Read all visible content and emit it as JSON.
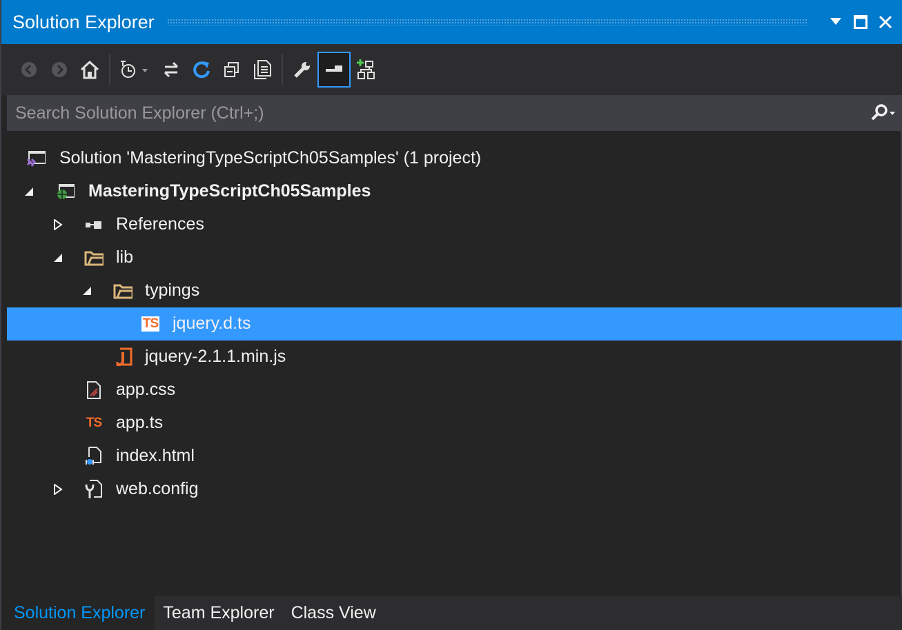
{
  "window": {
    "title": "Solution Explorer"
  },
  "colors": {
    "accent": "#007acc",
    "selection": "#3399ff",
    "background": "#252526",
    "ts_orange": "#f26b2a",
    "folder": "#dcb67a"
  },
  "toolbar": {
    "buttons": [
      {
        "name": "back",
        "icon": "back-arrow-icon"
      },
      {
        "name": "forward",
        "icon": "forward-arrow-icon"
      },
      {
        "name": "home",
        "icon": "home-icon"
      },
      {
        "name": "pending-changes-filter",
        "icon": "clock-filter-icon"
      },
      {
        "name": "sync-with-active-document",
        "icon": "sync-icon"
      },
      {
        "name": "refresh",
        "icon": "refresh-icon"
      },
      {
        "name": "collapse-all",
        "icon": "collapse-all-icon"
      },
      {
        "name": "show-all-files",
        "icon": "show-all-files-icon"
      },
      {
        "name": "properties",
        "icon": "wrench-icon"
      },
      {
        "name": "preview-selected-items",
        "icon": "preview-icon",
        "active": true
      },
      {
        "name": "view-class-diagram",
        "icon": "class-diagram-icon"
      }
    ]
  },
  "search": {
    "placeholder": "Search Solution Explorer (Ctrl+;)"
  },
  "tree": {
    "items": [
      {
        "label": "Solution 'MasteringTypeScriptCh05Samples' (1 project)",
        "icon": "solution-icon",
        "expander": "none"
      },
      {
        "label": "MasteringTypeScriptCh05Samples",
        "icon": "web-project-icon",
        "expander": "expanded",
        "bold": true
      },
      {
        "label": "References",
        "icon": "references-icon",
        "expander": "collapsed"
      },
      {
        "label": "lib",
        "icon": "folder-open-icon",
        "expander": "expanded"
      },
      {
        "label": "typings",
        "icon": "folder-open-icon",
        "expander": "expanded"
      },
      {
        "label": "jquery.d.ts",
        "icon": "ts-file-icon",
        "expander": "none",
        "selected": true
      },
      {
        "label": "jquery-2.1.1.min.js",
        "icon": "js-file-icon",
        "expander": "none"
      },
      {
        "label": "app.css",
        "icon": "css-file-icon",
        "expander": "none"
      },
      {
        "label": "app.ts",
        "icon": "ts-file-icon",
        "expander": "none"
      },
      {
        "label": "index.html",
        "icon": "html-file-icon",
        "expander": "none"
      },
      {
        "label": "web.config",
        "icon": "config-file-icon",
        "expander": "collapsed"
      }
    ],
    "ts_badge": "TS"
  },
  "tabs": [
    {
      "label": "Solution Explorer",
      "active": true
    },
    {
      "label": "Team Explorer",
      "active": false
    },
    {
      "label": "Class View",
      "active": false
    }
  ]
}
